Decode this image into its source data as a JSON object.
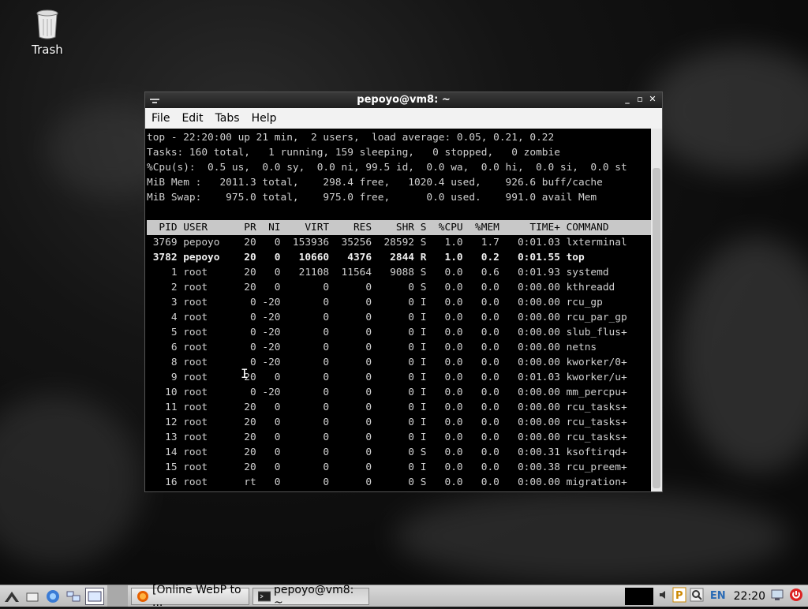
{
  "desktop": {
    "trash_label": "Trash"
  },
  "window": {
    "title": "pepoyo@vm8: ~",
    "menu": [
      "File",
      "Edit",
      "Tabs",
      "Help"
    ]
  },
  "terminal": {
    "summary": [
      "top - 22:20:00 up 21 min,  2 users,  load average: 0.05, 0.21, 0.22",
      "Tasks: 160 total,   1 running, 159 sleeping,   0 stopped,   0 zombie",
      "%Cpu(s):  0.5 us,  0.0 sy,  0.0 ni, 99.5 id,  0.0 wa,  0.0 hi,  0.0 si,  0.0 st",
      "MiB Mem :   2011.3 total,    298.4 free,   1020.4 used,    926.6 buff/cache",
      "MiB Swap:    975.0 total,    975.0 free,      0.0 used.    991.0 avail Mem"
    ],
    "columns": [
      "PID",
      "USER",
      "PR",
      "NI",
      "VIRT",
      "RES",
      "SHR",
      "S",
      "%CPU",
      "%MEM",
      "TIME+",
      "COMMAND"
    ],
    "processes": [
      [
        "3769",
        "pepoyo",
        "20",
        "0",
        "153936",
        "35256",
        "28592",
        "S",
        "1.0",
        "1.7",
        "0:01.03",
        "lxterminal"
      ],
      [
        "3782",
        "pepoyo",
        "20",
        "0",
        "10660",
        "4376",
        "2844",
        "R",
        "1.0",
        "0.2",
        "0:01.55",
        "top"
      ],
      [
        "1",
        "root",
        "20",
        "0",
        "21108",
        "11564",
        "9088",
        "S",
        "0.0",
        "0.6",
        "0:01.93",
        "systemd"
      ],
      [
        "2",
        "root",
        "20",
        "0",
        "0",
        "0",
        "0",
        "S",
        "0.0",
        "0.0",
        "0:00.00",
        "kthreadd"
      ],
      [
        "3",
        "root",
        "0",
        "-20",
        "0",
        "0",
        "0",
        "I",
        "0.0",
        "0.0",
        "0:00.00",
        "rcu_gp"
      ],
      [
        "4",
        "root",
        "0",
        "-20",
        "0",
        "0",
        "0",
        "I",
        "0.0",
        "0.0",
        "0:00.00",
        "rcu_par_gp"
      ],
      [
        "5",
        "root",
        "0",
        "-20",
        "0",
        "0",
        "0",
        "I",
        "0.0",
        "0.0",
        "0:00.00",
        "slub_flus+"
      ],
      [
        "6",
        "root",
        "0",
        "-20",
        "0",
        "0",
        "0",
        "I",
        "0.0",
        "0.0",
        "0:00.00",
        "netns"
      ],
      [
        "8",
        "root",
        "0",
        "-20",
        "0",
        "0",
        "0",
        "I",
        "0.0",
        "0.0",
        "0:00.00",
        "kworker/0+"
      ],
      [
        "9",
        "root",
        "20",
        "0",
        "0",
        "0",
        "0",
        "I",
        "0.0",
        "0.0",
        "0:01.03",
        "kworker/u+"
      ],
      [
        "10",
        "root",
        "0",
        "-20",
        "0",
        "0",
        "0",
        "I",
        "0.0",
        "0.0",
        "0:00.00",
        "mm_percpu+"
      ],
      [
        "11",
        "root",
        "20",
        "0",
        "0",
        "0",
        "0",
        "I",
        "0.0",
        "0.0",
        "0:00.00",
        "rcu_tasks+"
      ],
      [
        "12",
        "root",
        "20",
        "0",
        "0",
        "0",
        "0",
        "I",
        "0.0",
        "0.0",
        "0:00.00",
        "rcu_tasks+"
      ],
      [
        "13",
        "root",
        "20",
        "0",
        "0",
        "0",
        "0",
        "I",
        "0.0",
        "0.0",
        "0:00.00",
        "rcu_tasks+"
      ],
      [
        "14",
        "root",
        "20",
        "0",
        "0",
        "0",
        "0",
        "S",
        "0.0",
        "0.0",
        "0:00.31",
        "ksoftirqd+"
      ],
      [
        "15",
        "root",
        "20",
        "0",
        "0",
        "0",
        "0",
        "I",
        "0.0",
        "0.0",
        "0:00.38",
        "rcu_preem+"
      ],
      [
        "16",
        "root",
        "rt",
        "0",
        "0",
        "0",
        "0",
        "S",
        "0.0",
        "0.0",
        "0:00.00",
        "migration+"
      ]
    ],
    "bold_rows": [
      1
    ]
  },
  "taskbar": {
    "tasks": [
      {
        "label": "[Online WebP to ...",
        "icon": "firefox-icon"
      },
      {
        "label": "pepoyo@vm8: ~",
        "icon": "terminal-icon"
      }
    ],
    "lang": "EN",
    "clock": "22:20"
  }
}
